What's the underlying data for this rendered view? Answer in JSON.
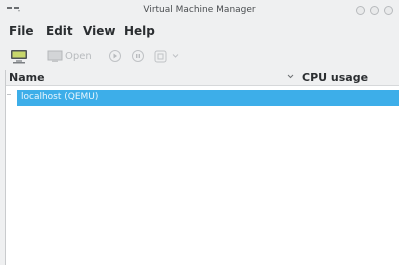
{
  "window": {
    "title": "Virtual Machine Manager"
  },
  "menubar": {
    "file": "File",
    "edit": "Edit",
    "view": "View",
    "help": "Help"
  },
  "toolbar": {
    "new_icon": "monitor-icon",
    "open_label": "Open",
    "run_icon": "play-icon",
    "pause_icon": "pause-icon",
    "shutdown_icon": "power-icon"
  },
  "list": {
    "columns": {
      "name": "Name",
      "cpu": "CPU usage"
    },
    "rows": [
      {
        "name": "localhost (QEMU)"
      }
    ]
  },
  "colors": {
    "selection": "#3daee9",
    "window_bg": "#eff0f1"
  }
}
